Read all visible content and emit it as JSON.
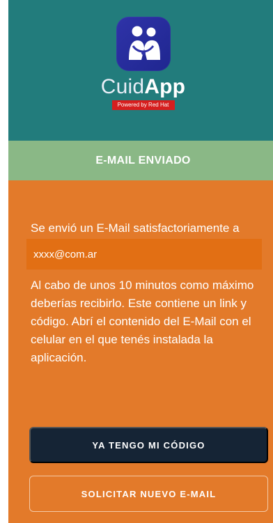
{
  "brand": {
    "name_prefix": "Cuid",
    "name_suffix": "App",
    "powered_by": "Powered by Red Hat",
    "logo_icon": "family-care-icon"
  },
  "status": {
    "title": "E-MAIL ENVIADO"
  },
  "content": {
    "sent_message": "Se envió un E-Mail satisfactoriamente a",
    "email": "xxxx@com.ar",
    "instructions": "Al cabo de unos 10 minutos como máximo deberías recibirlo. Este contiene un link y código. Abrí el contenido del E-Mail con el celular en el que tenés instalada la aplicación."
  },
  "actions": {
    "have_code_label": "YA TENGO MI CÓDIGO",
    "request_new_label": "SOLICITAR NUEVO E-MAIL"
  },
  "colors": {
    "header_bg": "#227c7c",
    "status_bg": "#8ab886",
    "main_bg": "#e37a2a",
    "email_box_bg": "#e26f14",
    "primary_button_bg": "#152435",
    "powered_bg": "#d61e1e"
  }
}
